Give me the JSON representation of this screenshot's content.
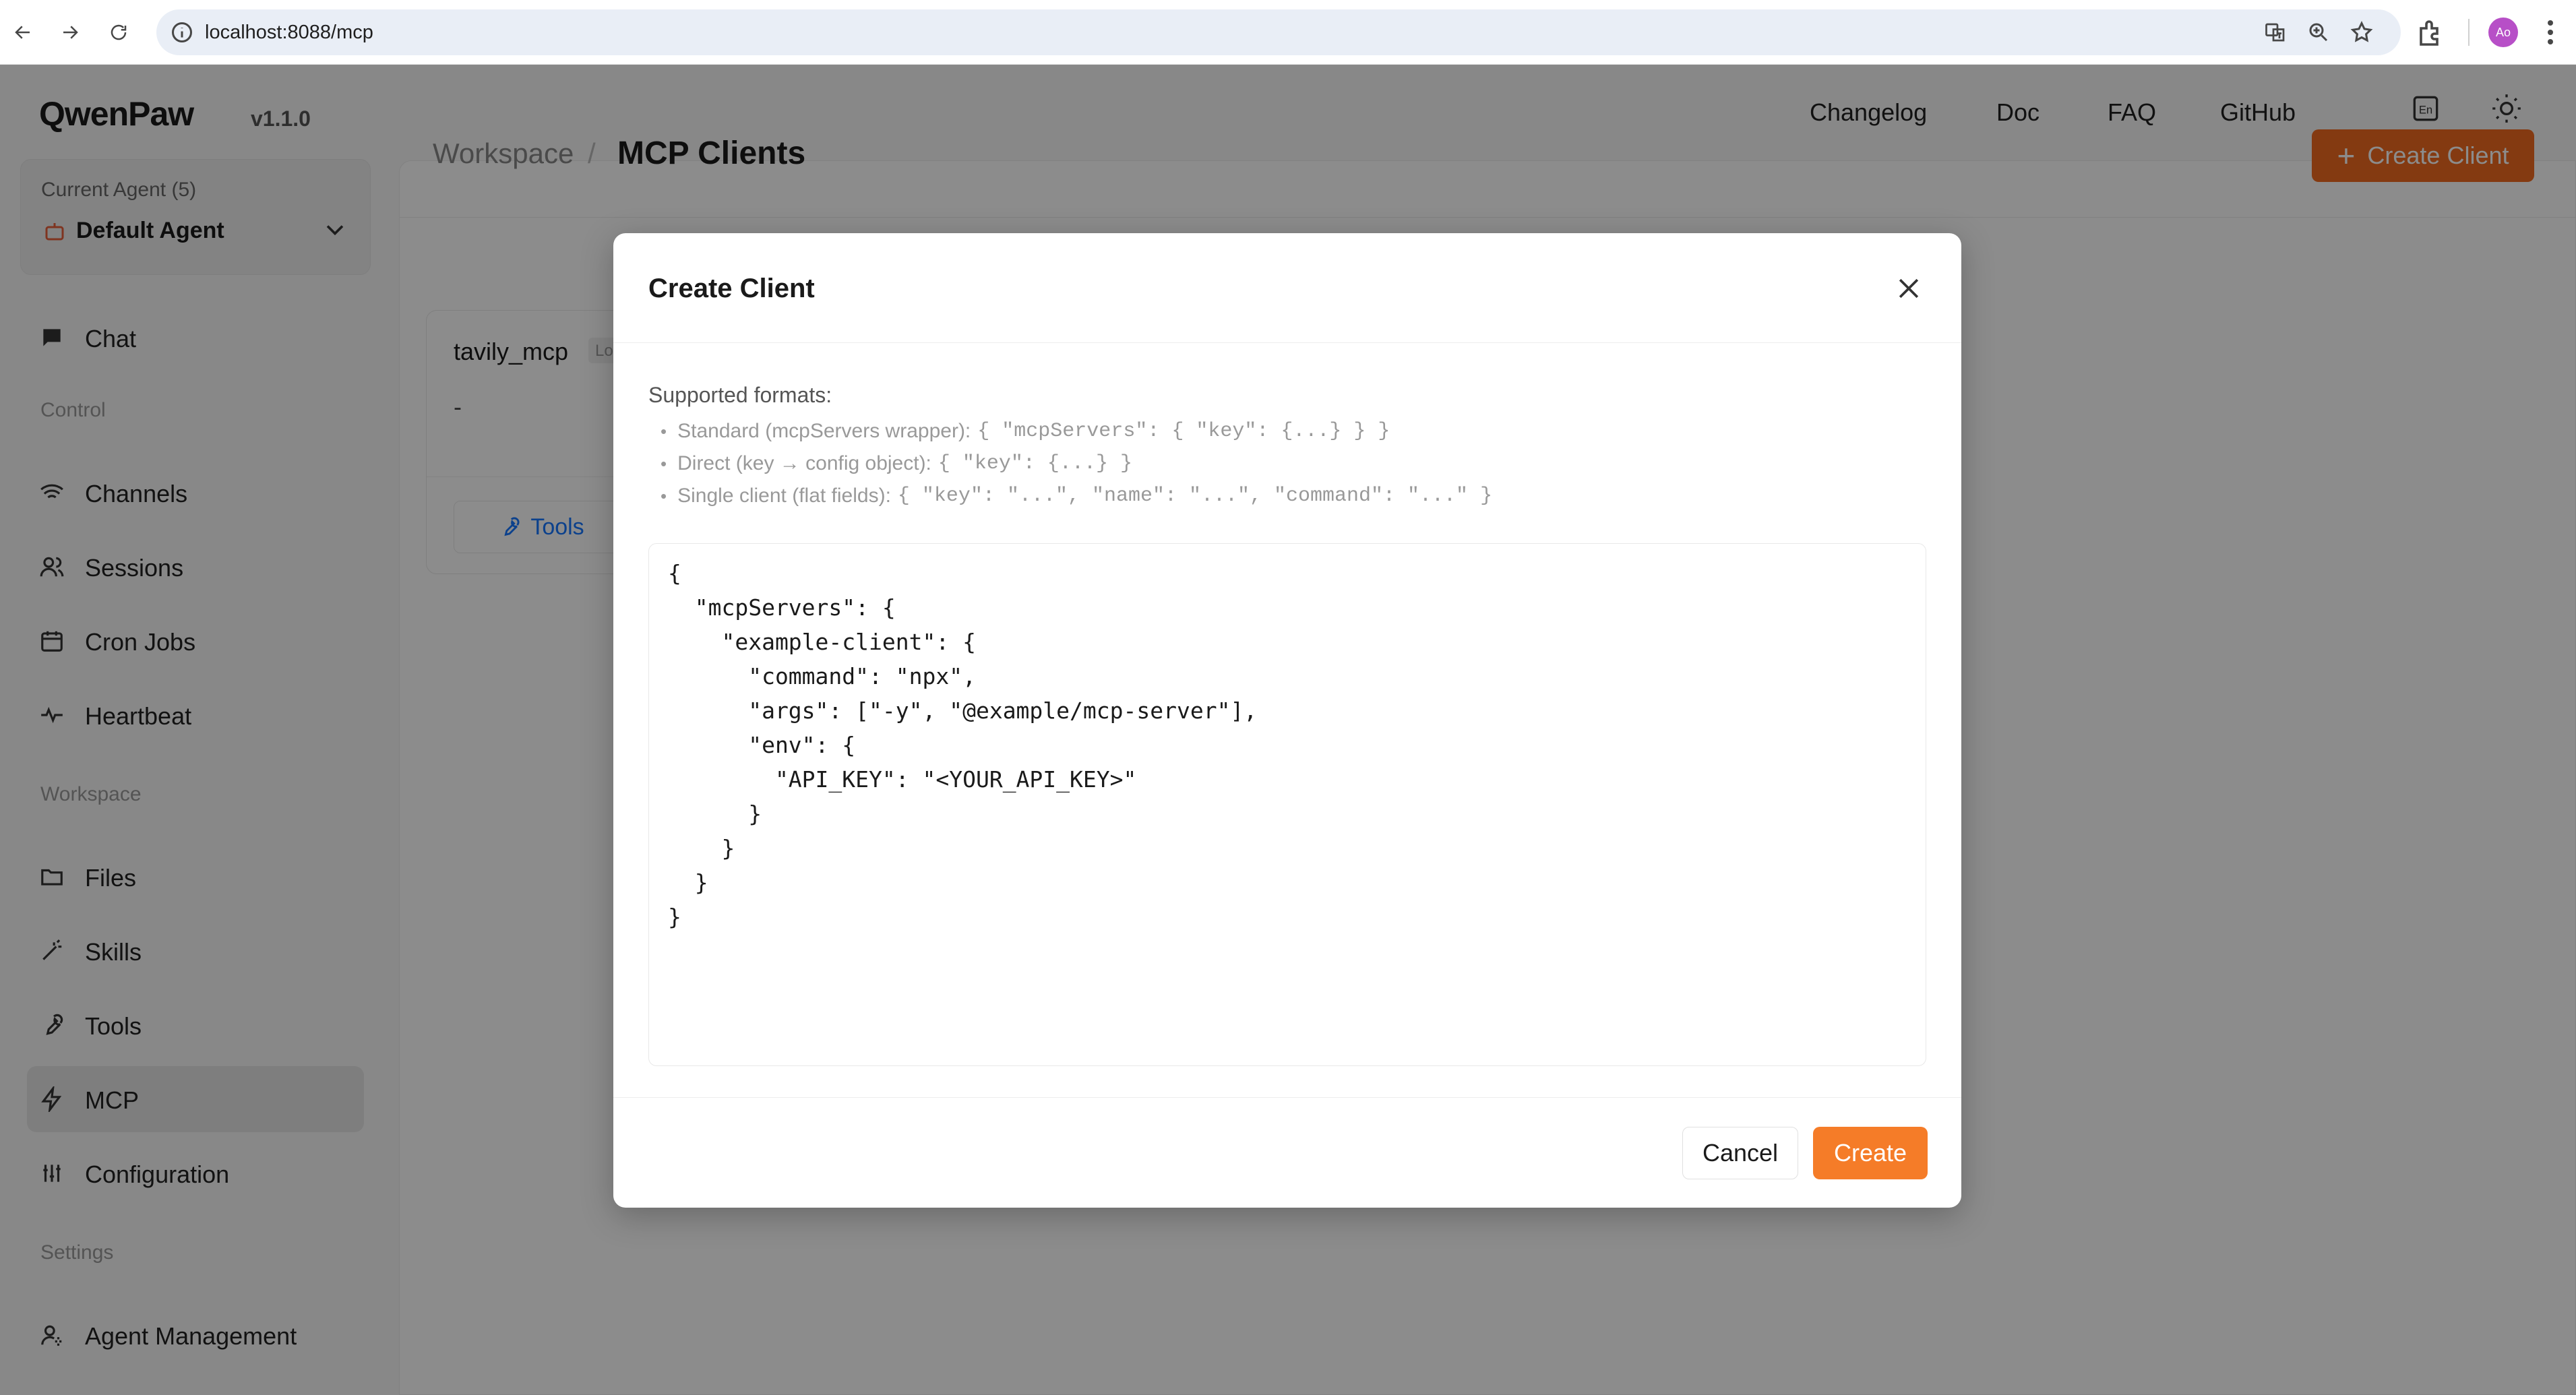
{
  "browser": {
    "url": "localhost:8088/mcp",
    "avatar_initials": "Ao"
  },
  "app": {
    "logo": "QwenPaw",
    "version": "v1.1.0",
    "nav": [
      "Changelog",
      "Doc",
      "FAQ",
      "GitHub"
    ],
    "lang_icon": "En"
  },
  "sidebar": {
    "agent_label": "Current Agent (5)",
    "agent_name": "Default Agent",
    "chat": "Chat",
    "section_control": "Control",
    "channels": "Channels",
    "sessions": "Sessions",
    "cron_jobs": "Cron Jobs",
    "heartbeat": "Heartbeat",
    "section_workspace": "Workspace",
    "files": "Files",
    "skills": "Skills",
    "tools": "Tools",
    "mcp": "MCP",
    "configuration": "Configuration",
    "section_settings": "Settings",
    "agent_management": "Agent Management"
  },
  "page": {
    "breadcrumb_parent": "Workspace",
    "breadcrumb_sep": "/",
    "title": "MCP Clients",
    "create_button": "Create Client"
  },
  "card": {
    "name": "tavily_mcp",
    "tag": "Local",
    "description": "-",
    "tools_button": "Tools"
  },
  "modal": {
    "title": "Create Client",
    "formats_title": "Supported formats:",
    "formats": [
      {
        "label": "Standard (mcpServers wrapper):",
        "code": "{ \"mcpServers\": { \"key\": {...} } }"
      },
      {
        "label": "Direct (key → config object):",
        "code": "{ \"key\": {...} }"
      },
      {
        "label": "Single client (flat fields):",
        "code": "{ \"key\": \"...\", \"name\": \"...\", \"command\": \"...\" }"
      }
    ],
    "editor_value": "{\n  \"mcpServers\": {\n    \"example-client\": {\n      \"command\": \"npx\",\n      \"args\": [\"-y\", \"@example/mcp-server\"],\n      \"env\": {\n        \"API_KEY\": \"<YOUR_API_KEY>\"\n      }\n    }\n  }\n}",
    "cancel": "Cancel",
    "create": "Create"
  },
  "colors": {
    "accent": "#f06a1f",
    "link": "#1677ff"
  }
}
